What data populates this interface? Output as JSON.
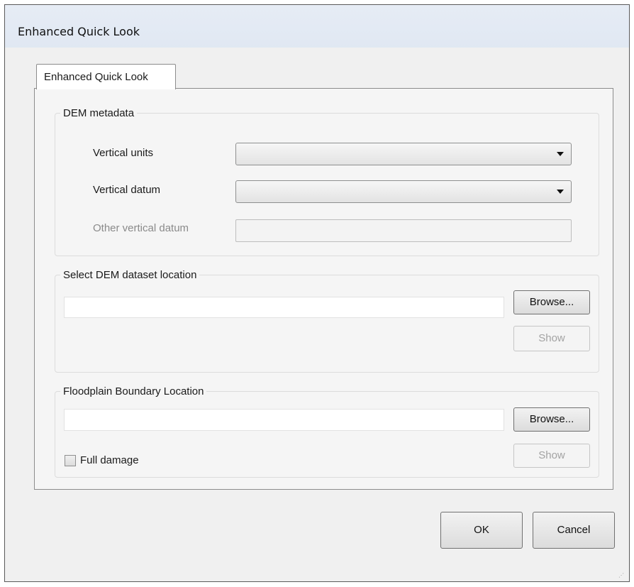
{
  "window": {
    "title": "Enhanced Quick Look"
  },
  "tabs": [
    {
      "label": "Enhanced Quick Look",
      "selected": true
    }
  ],
  "dem_metadata": {
    "group_label": "DEM metadata",
    "vertical_units": {
      "label": "Vertical units",
      "value": ""
    },
    "vertical_datum": {
      "label": "Vertical datum",
      "value": ""
    },
    "other_vertical_datum": {
      "label": "Other vertical datum",
      "value": "",
      "enabled": false
    }
  },
  "dem_dataset": {
    "group_label": "Select DEM dataset location",
    "path": "",
    "browse_label": "Browse...",
    "show_label": "Show"
  },
  "floodplain": {
    "group_label": "Floodplain Boundary Location",
    "path": "",
    "browse_label": "Browse...",
    "show_label": "Show",
    "full_damage_label": "Full damage",
    "full_damage_checked": false
  },
  "footer": {
    "ok_label": "OK",
    "cancel_label": "Cancel"
  }
}
